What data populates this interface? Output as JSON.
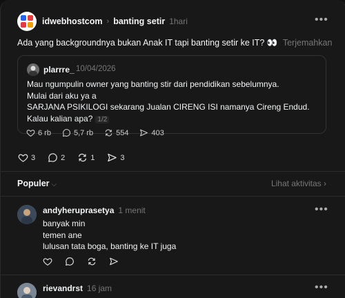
{
  "post": {
    "author": "idwebhostcom",
    "topic": "banting setir",
    "time": "1hari",
    "text": "Ada yang backgroundnya bukan Anak IT tapi banting setir ke IT? 👀",
    "translate_label": "Terjemahkan",
    "quote": {
      "author": "plarrre_",
      "date": "10/04/2026",
      "lines": [
        "Mau ngumpulin owner yang banting stir dari pendidikan sebelumnya.",
        "Mulai dari aku ya a",
        "SARJANA PSIKILOGI sekarang Jualan CIRENG ISI namanya Cireng Endud.",
        "Kalau kalian apa?"
      ],
      "page": "1/2",
      "likes": "6 rb",
      "comments": "5,7 rb",
      "reposts": "554",
      "shares": "403"
    },
    "likes": "3",
    "comments": "2",
    "reposts": "1",
    "shares": "3"
  },
  "sort": {
    "label": "Populer",
    "activity_label": "Lihat aktivitas"
  },
  "replies": [
    {
      "author": "andyheruprasetya",
      "time": "1 menit",
      "lines": [
        "banyak min",
        "temen ane",
        "lulusan tata boga, banting ke IT juga"
      ]
    },
    {
      "author": "rievandrst",
      "time": "16 jam",
      "lines": []
    }
  ],
  "colors": {
    "background": "#181818",
    "muted": "#777777",
    "text": "#f3f5f7",
    "brand_red": "#e63946",
    "brand_blue": "#2563eb"
  }
}
